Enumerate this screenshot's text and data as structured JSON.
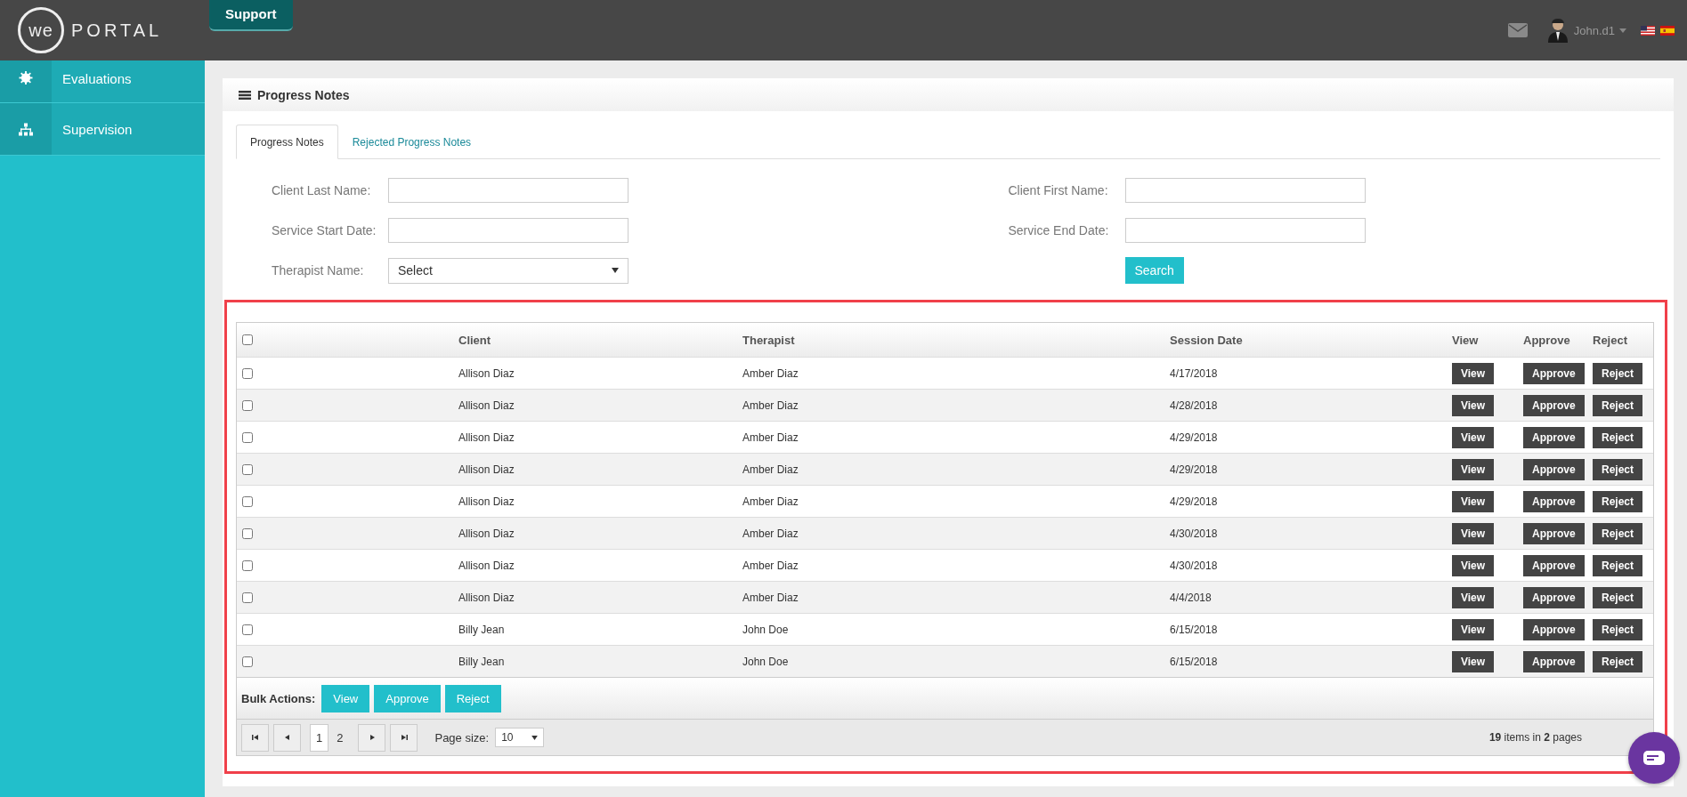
{
  "header": {
    "logo_circle": "we",
    "logo_text": "PORTAL",
    "support_tab": "Support",
    "user": "John.d1"
  },
  "sidebar": {
    "items": [
      {
        "label": "Evaluations",
        "kind": "gear"
      },
      {
        "label": "Supervision",
        "kind": "tree"
      }
    ]
  },
  "panel": {
    "title": "Progress Notes",
    "tabs": [
      {
        "label": "Progress Notes",
        "selected": true
      },
      {
        "label": "Rejected Progress Notes",
        "selected": false
      }
    ],
    "filters": {
      "left": [
        {
          "label": "Client Last Name:",
          "kind": "text"
        },
        {
          "label": "Service Start Date:",
          "kind": "text"
        },
        {
          "label": "Therapist Name:",
          "kind": "select",
          "value": "Select"
        }
      ],
      "right": [
        {
          "label": "Client First Name:",
          "kind": "text"
        },
        {
          "label": "Service End Date:",
          "kind": "text"
        }
      ],
      "search_button": "Search"
    },
    "table": {
      "select_all_checked": false,
      "columns": [
        "Client",
        "Therapist",
        "Session Date",
        "View",
        "Approve",
        "Reject"
      ],
      "rows": [
        {
          "checked": false,
          "client": "Allison Diaz",
          "therapist": "Amber Diaz",
          "date": "4/17/2018",
          "actions": [
            "View",
            "Approve",
            "Reject"
          ]
        },
        {
          "checked": false,
          "client": "Allison Diaz",
          "therapist": "Amber Diaz",
          "date": "4/28/2018",
          "actions": [
            "View",
            "Approve",
            "Reject"
          ]
        },
        {
          "checked": false,
          "client": "Allison Diaz",
          "therapist": "Amber Diaz",
          "date": "4/29/2018",
          "actions": [
            "View",
            "Approve",
            "Reject"
          ]
        },
        {
          "checked": false,
          "client": "Allison Diaz",
          "therapist": "Amber Diaz",
          "date": "4/29/2018",
          "actions": [
            "View",
            "Approve",
            "Reject"
          ]
        },
        {
          "checked": false,
          "client": "Allison Diaz",
          "therapist": "Amber Diaz",
          "date": "4/29/2018",
          "actions": [
            "View",
            "Approve",
            "Reject"
          ]
        },
        {
          "checked": false,
          "client": "Allison Diaz",
          "therapist": "Amber Diaz",
          "date": "4/30/2018",
          "actions": [
            "View",
            "Approve",
            "Reject"
          ]
        },
        {
          "checked": false,
          "client": "Allison Diaz",
          "therapist": "Amber Diaz",
          "date": "4/30/2018",
          "actions": [
            "View",
            "Approve",
            "Reject"
          ]
        },
        {
          "checked": false,
          "client": "Allison Diaz",
          "therapist": "Amber Diaz",
          "date": "4/4/2018",
          "actions": [
            "View",
            "Approve",
            "Reject"
          ]
        },
        {
          "checked": false,
          "client": "Billy Jean",
          "therapist": "John Doe",
          "date": "6/15/2018",
          "actions": [
            "View",
            "Approve",
            "Reject"
          ]
        },
        {
          "checked": false,
          "client": "Billy Jean",
          "therapist": "John Doe",
          "date": "6/15/2018",
          "actions": [
            "View",
            "Approve",
            "Reject"
          ]
        }
      ],
      "bulk_label": "Bulk Actions:",
      "bulk_buttons": [
        "View",
        "Approve",
        "Reject"
      ],
      "pager": {
        "pages": [
          {
            "label": "1",
            "selected": true
          },
          {
            "label": "2",
            "selected": false
          }
        ],
        "page_size_label": "Page size:",
        "page_size": "10",
        "summary": "**19** items in **2** pages"
      }
    }
  }
}
